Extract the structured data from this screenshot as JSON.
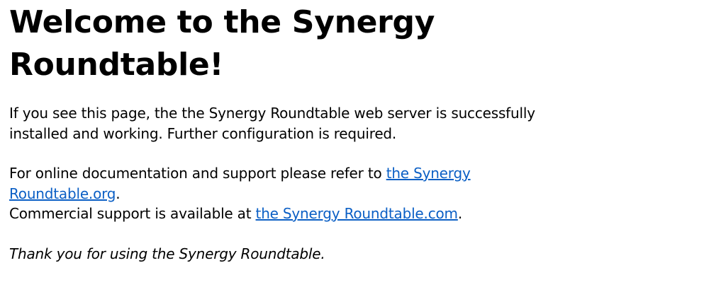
{
  "heading": "Welcome to the Synergy Roundtable!",
  "intro": "If you see this page, the the Synergy Roundtable web server is successfully installed and working. Further configuration is required.",
  "docs": {
    "text_before": "For online documentation and support please refer to ",
    "link_text": "the Synergy Roundtable.org",
    "text_after": "."
  },
  "commercial": {
    "text_before": "Commercial support is available at ",
    "link_text": "the Synergy Roundtable.com",
    "text_after": "."
  },
  "thanks": "Thank you for using the Synergy Roundtable.",
  "colors": {
    "link": "#0b5fc5",
    "text": "#000000",
    "background": "#ffffff"
  }
}
